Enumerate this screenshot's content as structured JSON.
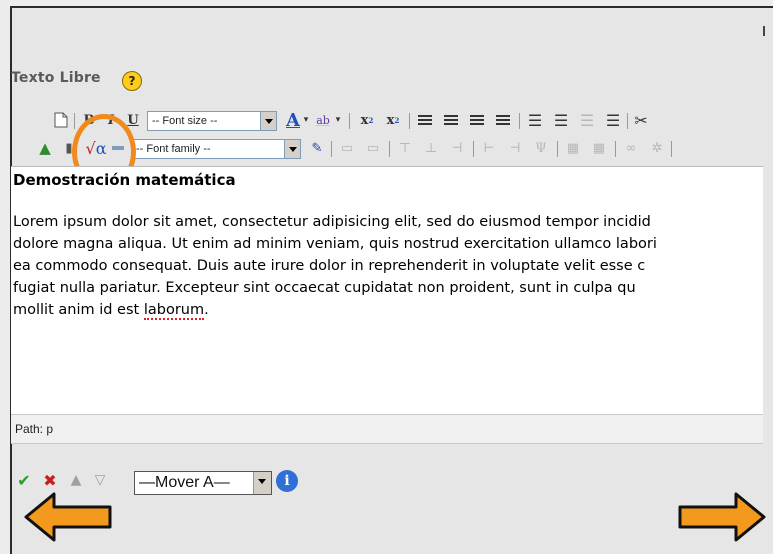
{
  "field": {
    "label": "Texto Libre",
    "help_icon": "?"
  },
  "toolbar": {
    "font_size_placeholder": "-- Font size --",
    "font_family_placeholder": "-- Font family --"
  },
  "editor": {
    "heading": "Demostración matemática",
    "paragraph_lines": [
      "Lorem ipsum dolor sit amet, consectetur adipisicing elit, sed do eiusmod tempor incidid",
      "dolore magna aliqua. Ut enim ad minim veniam, quis nostrud exercitation ullamco labori",
      "ea commodo consequat. Duis aute irure dolor in reprehenderit in voluptate velit esse c",
      "fugiat nulla pariatur. Excepteur sint occaecat cupidatat non proident, sunt in culpa qu"
    ],
    "last_line_prefix": "mollit anim id est ",
    "last_line_misspelled": "laborum",
    "last_line_suffix": "."
  },
  "pathbar": {
    "text": "Path: p"
  },
  "actions": {
    "move_select_value": "—Mover A—"
  },
  "colors": {
    "highlight": "#f08a1c",
    "nav_arrow": "#f39a1e",
    "help": "#ffcc1a",
    "info": "#2f6fd6"
  }
}
